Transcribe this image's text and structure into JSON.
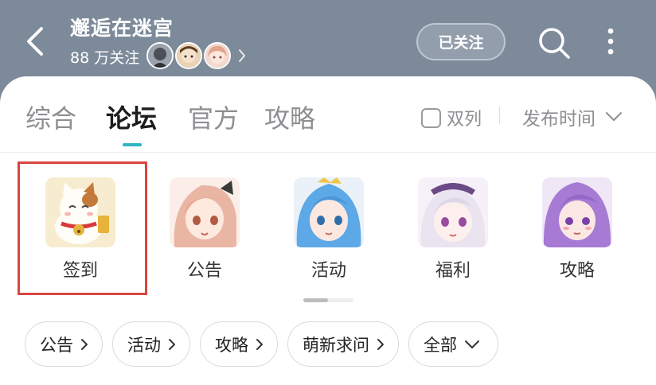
{
  "header": {
    "title": "邂逅在迷宫",
    "followers": "88 万关注",
    "follow_label": "已关注"
  },
  "tabs": [
    {
      "label": "综合",
      "active": false
    },
    {
      "label": "论坛",
      "active": true
    },
    {
      "label": "官方",
      "active": false
    },
    {
      "label": "攻略",
      "active": false
    }
  ],
  "view": {
    "dual_column_label": "双列",
    "sort_label": "发布时间"
  },
  "quick_entries": [
    {
      "label": "签到",
      "icon": "lucky-cat-icon"
    },
    {
      "label": "公告",
      "icon": "pink-hair-girl-icon"
    },
    {
      "label": "活动",
      "icon": "blue-hair-girl-icon"
    },
    {
      "label": "福利",
      "icon": "white-hair-maid-icon"
    },
    {
      "label": "攻略",
      "icon": "purple-hair-girl-icon"
    }
  ],
  "chips": [
    {
      "label": "公告"
    },
    {
      "label": "活动"
    },
    {
      "label": "攻略"
    },
    {
      "label": "萌新求问"
    },
    {
      "label": "全部"
    }
  ],
  "colors": {
    "header_bg": "#7d8a9a",
    "accent": "#2eb5be",
    "highlight": "#d9453f"
  }
}
